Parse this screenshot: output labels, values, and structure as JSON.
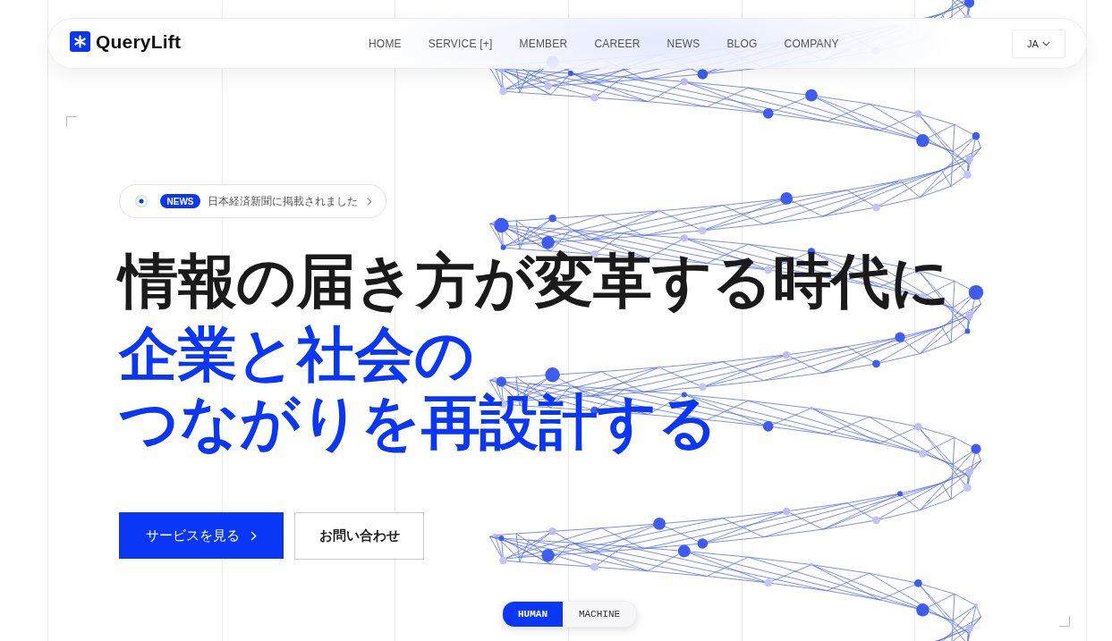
{
  "nav": {
    "logo": "QueryLift",
    "links": [
      "HOME",
      "SERVICE [+]",
      "MEMBER",
      "CAREER",
      "NEWS",
      "BLOG",
      "COMPANY"
    ],
    "language": "JA"
  },
  "news": {
    "badge": "NEWS",
    "text": "日本経済新聞に掲載されました"
  },
  "headline": [
    {
      "text": "情報の届き方が変革する時代に",
      "accent": false
    },
    {
      "text": "企業と社会の",
      "accent": true
    },
    {
      "text": "つながりを再設計する",
      "accent": true
    }
  ],
  "buttons": [
    {
      "label": "サービスを見る",
      "kind": "primary"
    },
    {
      "label": "お問い合わせ",
      "kind": "secondary"
    }
  ],
  "mode_toggle": [
    {
      "label": "HUMAN",
      "selected": true
    },
    {
      "label": "MACHINE",
      "selected": false
    }
  ]
}
